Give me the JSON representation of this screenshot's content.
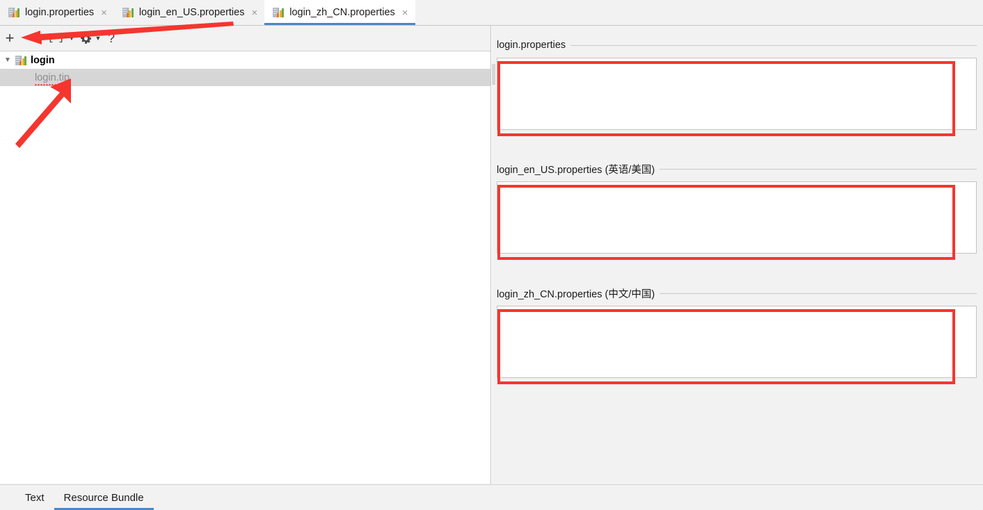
{
  "editor_tabs": [
    {
      "label": "login.properties",
      "icon": "properties-bundle-icon",
      "close": "×",
      "active": false
    },
    {
      "label": "login_en_US.properties",
      "icon": "properties-bundle-icon",
      "close": "×",
      "active": false
    },
    {
      "label": "login_zh_CN.properties",
      "icon": "properties-bundle-icon",
      "close": "×",
      "active": true
    }
  ],
  "toolbar": {
    "add_label": "+",
    "remove_label": "−",
    "collapse_label": "[=]",
    "collapse_caret": "▼",
    "settings_icon": "gear-icon",
    "settings_caret": "▼",
    "help_label": "?"
  },
  "tree": {
    "root": {
      "toggle": "▼",
      "label": "login",
      "icon": "properties-bundle-icon"
    },
    "items": [
      {
        "label": "login.tip",
        "selected": true,
        "error": true
      }
    ]
  },
  "properties": [
    {
      "title": "login.properties",
      "value": "",
      "placeholder": ""
    },
    {
      "title": "login_en_US.properties (英语/美国)",
      "value": "",
      "placeholder": ""
    },
    {
      "title": "login_zh_CN.properties (中文/中国)",
      "value": "",
      "placeholder": ""
    }
  ],
  "bottom_tabs": [
    {
      "label": "Text",
      "active": false
    },
    {
      "label": "Resource Bundle",
      "active": true
    }
  ],
  "colors": {
    "accent": "#4a86c8",
    "annotation": "#f4362f",
    "panel": "#f2f2f2",
    "selection": "#d6d6d6",
    "error": "#e8453c"
  }
}
